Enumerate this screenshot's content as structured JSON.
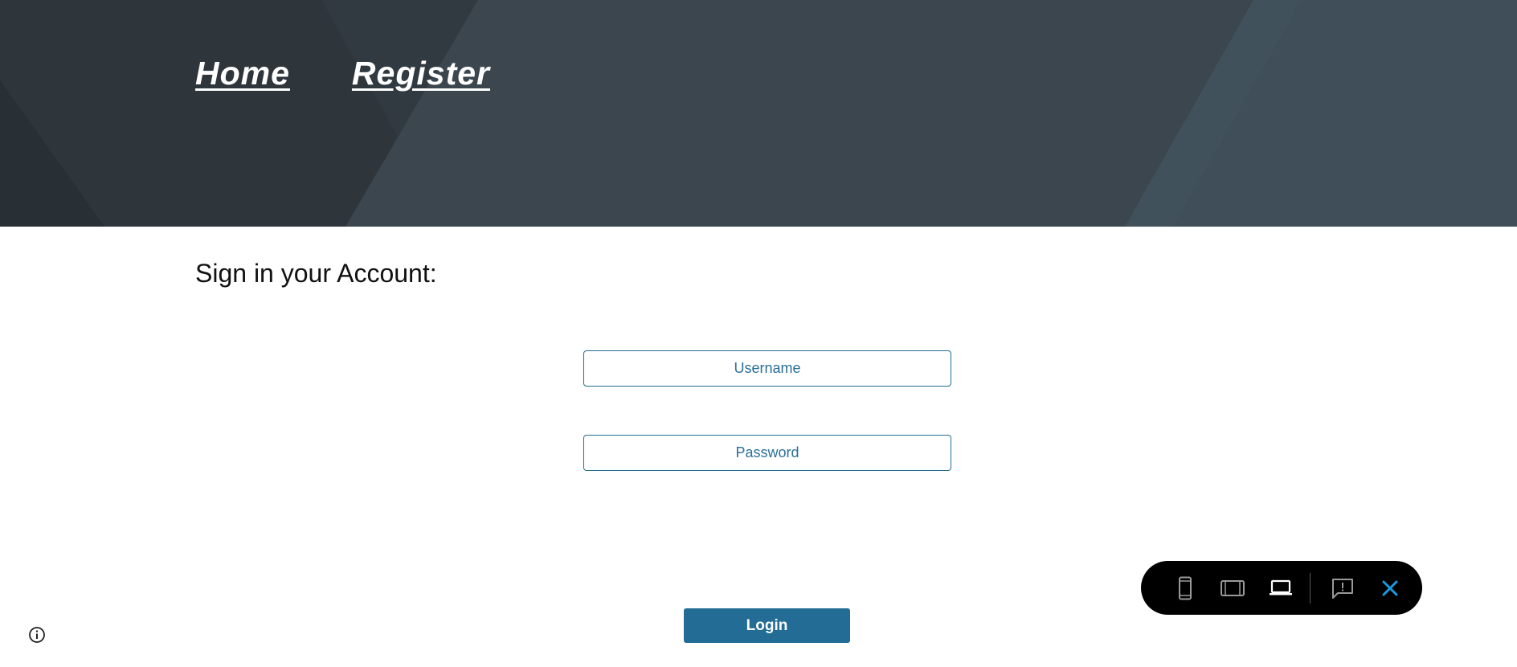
{
  "nav": {
    "links": [
      {
        "label": "Home"
      },
      {
        "label": "Register"
      }
    ]
  },
  "main": {
    "heading": "Sign in your Account:",
    "username_placeholder": "Username",
    "password_placeholder": "Password",
    "login_label": "Login"
  },
  "toolbar": {
    "buttons": [
      {
        "icon": "mobile-icon",
        "active": false
      },
      {
        "icon": "tablet-icon",
        "active": false
      },
      {
        "icon": "laptop-icon",
        "active": true
      },
      {
        "icon": "feedback-icon",
        "active": false
      },
      {
        "icon": "close-icon",
        "active": false
      }
    ]
  },
  "colors": {
    "banner": "#39434b",
    "accent": "#226c95",
    "close": "#1a9be0"
  },
  "info_icon": "info-icon"
}
